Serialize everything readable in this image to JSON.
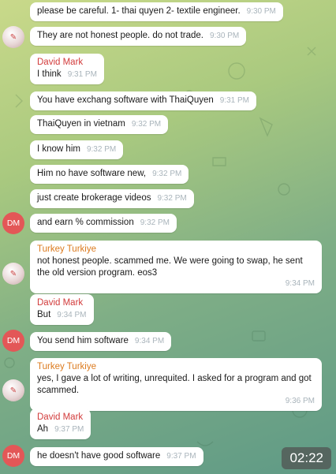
{
  "messages": [
    {
      "sender": "",
      "text": "please be careful.  1- thai quyen 2- textile engineer.",
      "time": "9:30 PM"
    },
    {
      "sender": "",
      "text": "They are not honest people.  do not trade.",
      "time": "9:30 PM"
    },
    {
      "sender": "David Mark",
      "text": "I think",
      "time": "9:31 PM"
    },
    {
      "sender": "",
      "text": "You have exchang software with ThaiQuyen",
      "time": "9:31 PM"
    },
    {
      "sender": "",
      "text": "ThaiQuyen in vietnam",
      "time": "9:32 PM"
    },
    {
      "sender": "",
      "text": "I know him",
      "time": "9:32 PM"
    },
    {
      "sender": "",
      "text": "Him no have software new,",
      "time": "9:32 PM"
    },
    {
      "sender": "",
      "text": "just create brokerage videos",
      "time": "9:32 PM"
    },
    {
      "sender": "",
      "text": "and earn % commission",
      "time": "9:32 PM"
    },
    {
      "sender": "Turkey Turkiye",
      "text": "not honest people.  scammed me.  We were going to swap, he sent the old version program.  eos3",
      "time": "9:34 PM"
    },
    {
      "sender": "David Mark",
      "text": "But",
      "time": "9:34 PM"
    },
    {
      "sender": "",
      "text": "You send him software",
      "time": "9:34 PM"
    },
    {
      "sender": "Turkey Turkiye",
      "text": "yes, I gave a lot of writing,  unrequited.  I asked for a program and got scammed.",
      "time": "9:36 PM"
    },
    {
      "sender": "David Mark",
      "text": "Ah",
      "time": "9:37 PM"
    },
    {
      "sender": "",
      "text": "he doesn't have good software",
      "time": "9:37 PM"
    }
  ],
  "avatars": {
    "dm_initials": "DM"
  },
  "video_time": "02:22",
  "colors": {
    "david": "#d23b3b",
    "turkey": "#dc7a1e",
    "dm_avatar": "#e35757"
  }
}
